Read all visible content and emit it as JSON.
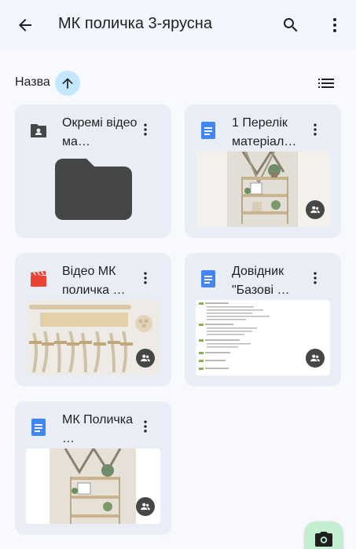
{
  "header": {
    "title": "МК поличка 3-ярусна"
  },
  "sort": {
    "label": "Назва"
  },
  "files": [
    {
      "name": "Окремі відео ма…",
      "type": "folder"
    },
    {
      "name": "1 Перелік матеріал…",
      "type": "doc"
    },
    {
      "name": "Відео МК поличка …",
      "type": "video"
    },
    {
      "name": "Довідник \"Базові …",
      "type": "doc"
    },
    {
      "name": "МК Поличка …",
      "type": "doc"
    }
  ],
  "colors": {
    "doc": "#4285f4",
    "video": "#ea4335",
    "folder": "#444746",
    "accent": "#c2e7ff",
    "fab": "#c4eed0"
  },
  "icons": {
    "back": "arrow-back",
    "search": "search",
    "more": "more-vert",
    "sort": "arrow-up",
    "view": "list-view",
    "fab": "camera"
  }
}
